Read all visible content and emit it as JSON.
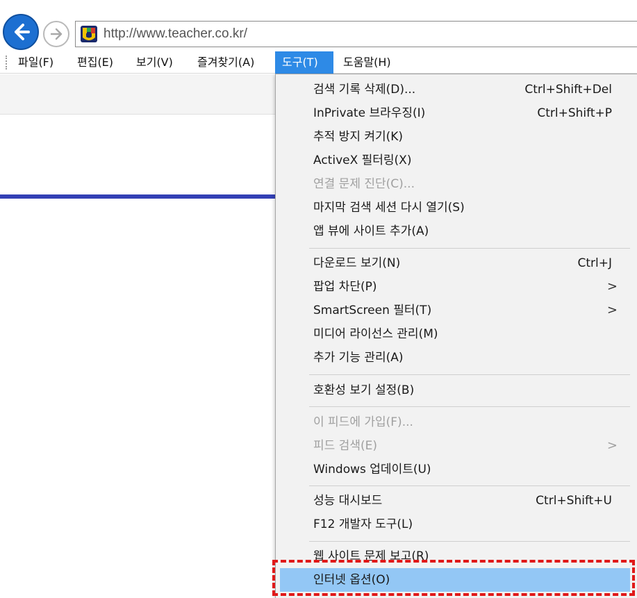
{
  "address_bar": {
    "url": "http://www.teacher.co.kr/",
    "site_icon": "teacher-site-favicon"
  },
  "icons": {
    "back": "back-arrow-icon",
    "forward": "forward-arrow-icon"
  },
  "menubar": {
    "items": [
      "파일(F)",
      "편집(E)",
      "보기(V)",
      "즐겨찾기(A)",
      "도구(T)",
      "도움말(H)"
    ],
    "active": "도구(T)"
  },
  "tools_menu": {
    "items": [
      {
        "label": "검색 기록 삭제(D)...",
        "shortcut": "Ctrl+Shift+Del"
      },
      {
        "label": "InPrivate 브라우징(I)",
        "shortcut": "Ctrl+Shift+P"
      },
      {
        "label": "추적 방지 켜기(K)"
      },
      {
        "label": "ActiveX 필터링(X)"
      },
      {
        "label": "연결 문제 진단(C)...",
        "disabled": true
      },
      {
        "label": "마지막 검색 세션 다시 열기(S)"
      },
      {
        "label": "앱 뷰에 사이트 추가(A)"
      },
      {
        "label": "다운로드 보기(N)",
        "shortcut": "Ctrl+J"
      },
      {
        "label": "팝업 차단(P)",
        "submenu": ">"
      },
      {
        "label": "SmartScreen 필터(T)",
        "submenu": ">"
      },
      {
        "label": "미디어 라이선스 관리(M)"
      },
      {
        "label": "추가 기능 관리(A)"
      },
      {
        "label": "호환성 보기 설정(B)"
      },
      {
        "label": "이 피드에 가입(F)...",
        "disabled": true
      },
      {
        "label": "피드 검색(E)",
        "disabled": true,
        "submenu": ">"
      },
      {
        "label": "Windows 업데이트(U)"
      },
      {
        "label": "성능 대시보드",
        "shortcut": "Ctrl+Shift+U"
      },
      {
        "label": "F12 개발자 도구(L)"
      },
      {
        "label": "웹 사이트 문제 보고(R)"
      },
      {
        "label": "인터넷 옵션(O)",
        "highlighted": true
      }
    ]
  },
  "colors": {
    "menu_active": "#2e8ae6",
    "highlight": "#93c7f5",
    "annotation_box": "#e01818",
    "page_accent_line": "#3340b5"
  }
}
